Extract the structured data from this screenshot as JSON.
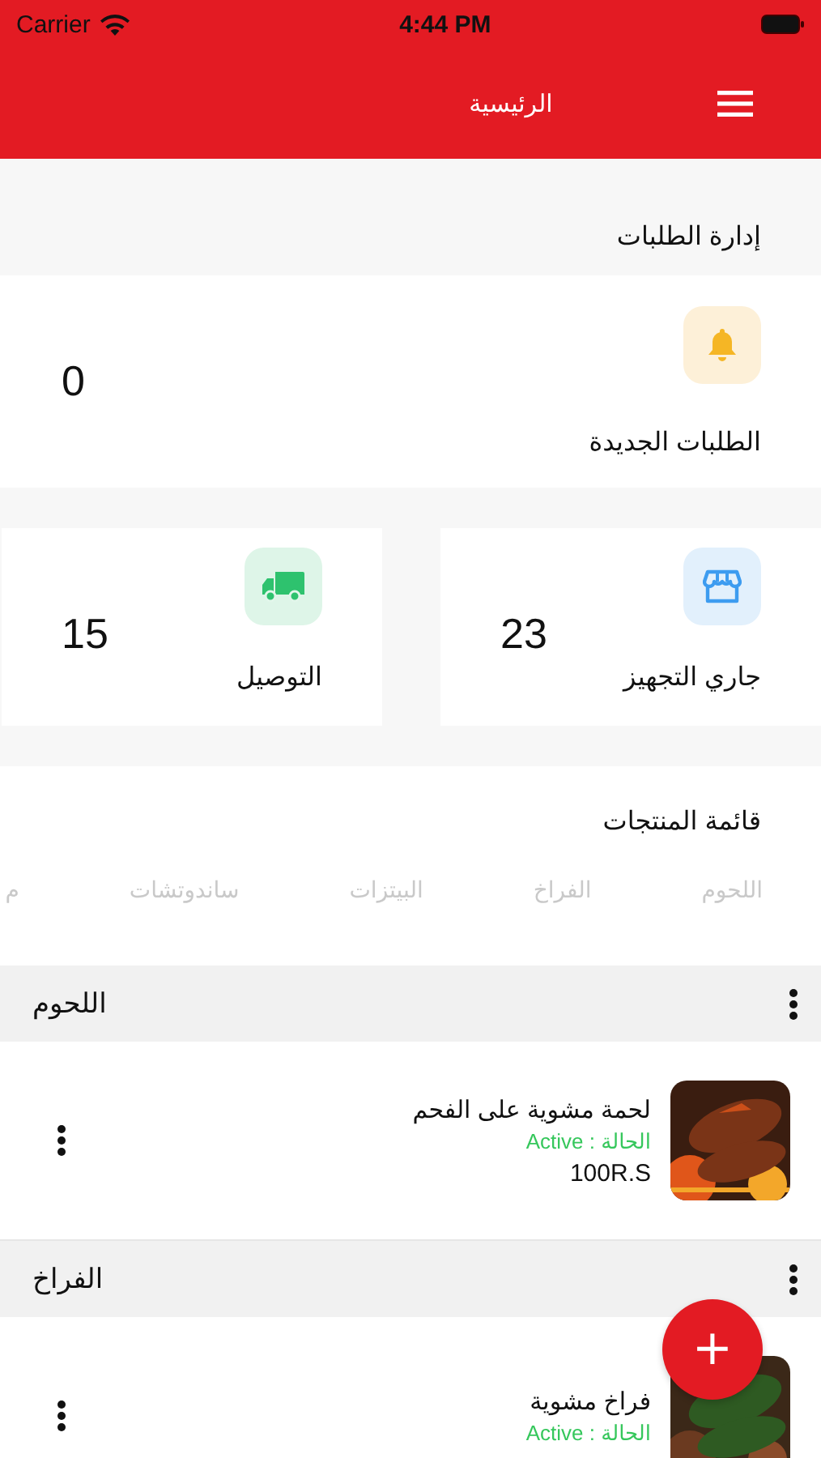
{
  "status_bar": {
    "carrier": "Carrier",
    "time": "4:44 PM"
  },
  "nav": {
    "title": "الرئيسية"
  },
  "orders": {
    "title": "إدارة الطلبات",
    "cards": [
      {
        "kind": "bell",
        "label": "الطلبات الجديدة",
        "count": "0"
      },
      {
        "kind": "store",
        "label": "جاري التجهيز",
        "count": "23"
      },
      {
        "kind": "truck",
        "label": "التوصيل",
        "count": "15"
      }
    ]
  },
  "products": {
    "title": "قائمة المنتجات",
    "categories": [
      "اللحوم",
      "الفراخ",
      "البيتزات",
      "ساندوتشات",
      "م"
    ],
    "sections": [
      {
        "title": "اللحوم",
        "items": [
          {
            "name": "لحمة مشوية على الفحم",
            "status": "الحالة : Active",
            "price": "100R.S"
          }
        ]
      },
      {
        "title": "الفراخ",
        "items": [
          {
            "name": "فراخ مشوية",
            "status": "الحالة : Active"
          }
        ]
      }
    ]
  },
  "fab": {
    "label": "+"
  }
}
